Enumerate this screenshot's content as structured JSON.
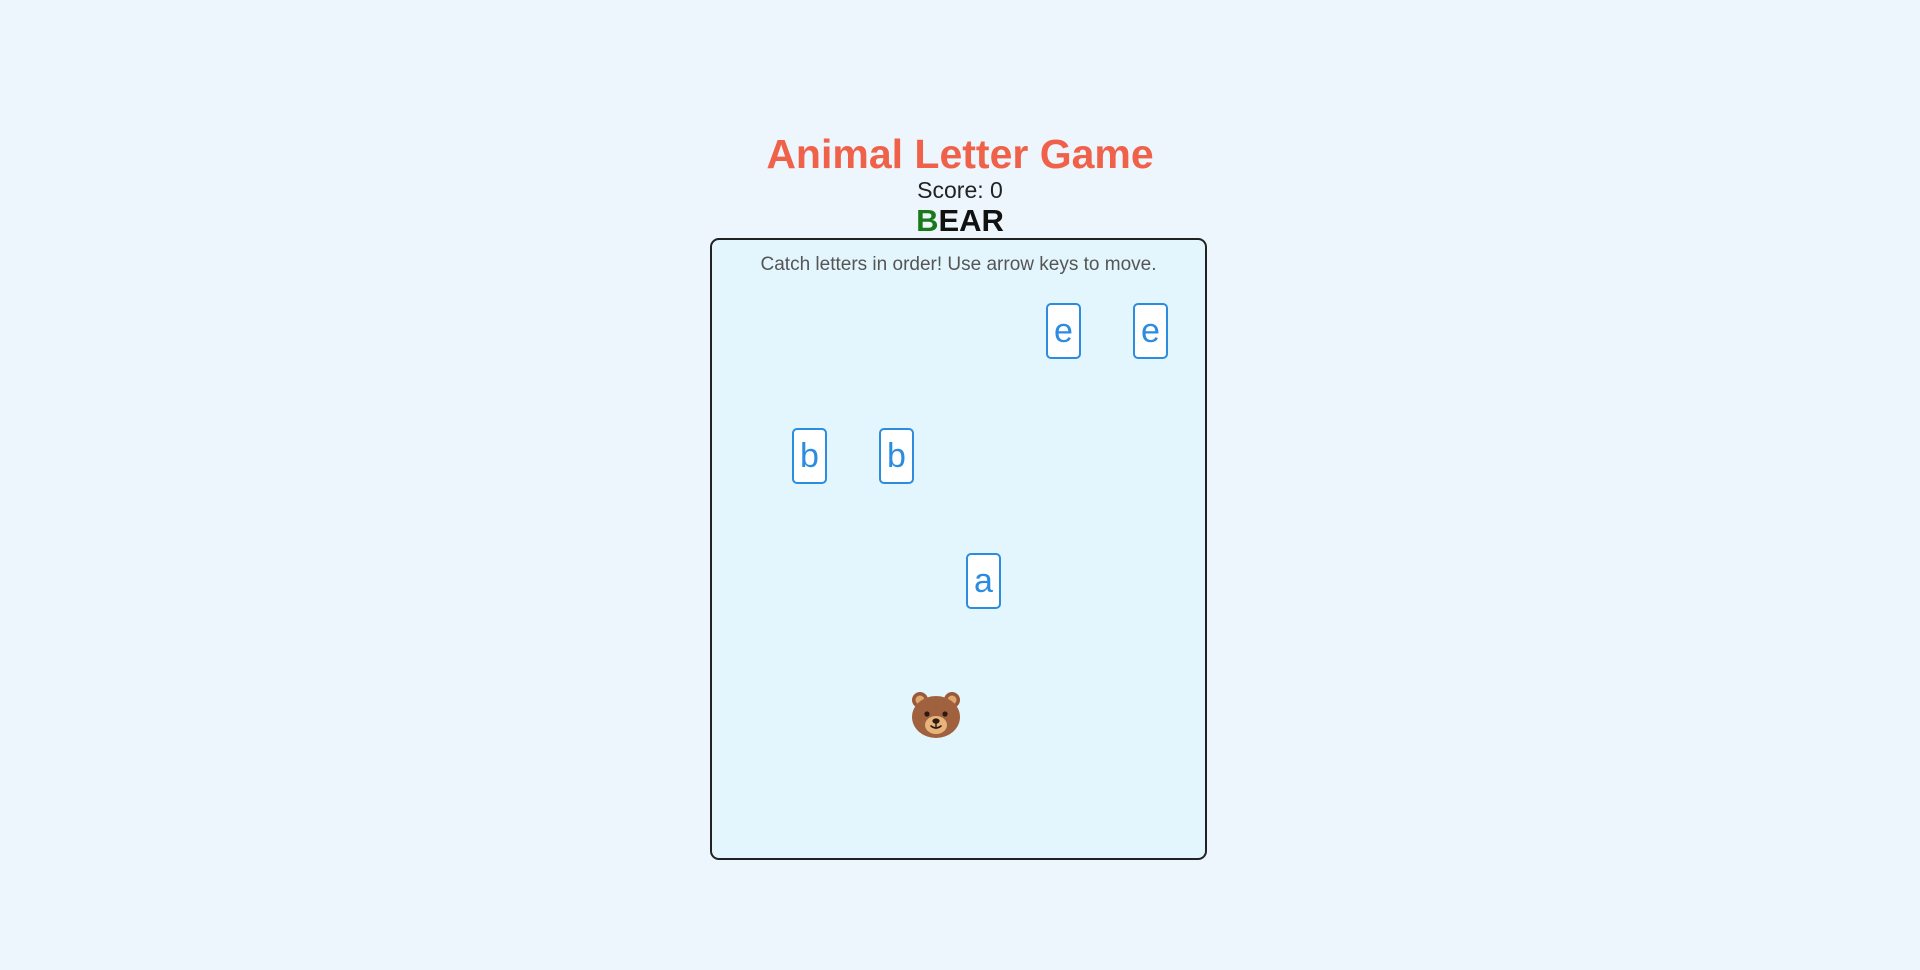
{
  "game": {
    "title": "Animal Letter Game",
    "score_text": "Score: 0",
    "target_word": {
      "caught": "B",
      "remaining": "EAR"
    },
    "instructions": "Catch letters in order! Use arrow keys to move.",
    "player_icon": "bear-face-icon",
    "falling_letters": [
      {
        "char": "e"
      },
      {
        "char": "e"
      },
      {
        "char": "b"
      },
      {
        "char": "b"
      },
      {
        "char": "a"
      }
    ]
  },
  "colors": {
    "title": "#f0614a",
    "caught_letter": "#1a7a1a",
    "letter_tile": "#2b8ce0",
    "board_bg": "#e4f6fd",
    "page_bg": "#eef6fd"
  }
}
